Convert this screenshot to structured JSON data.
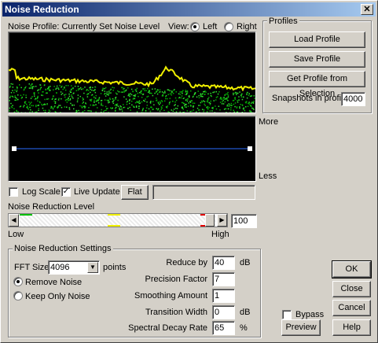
{
  "window": {
    "title": "Noise Reduction",
    "close_glyph": "✕"
  },
  "profile": {
    "caption": "Noise Profile: Currently Set Noise Level",
    "view_label": "View:",
    "view_left": "Left",
    "view_right": "Right",
    "view_selected": "Left"
  },
  "side_labels": {
    "more": "More",
    "less": "Less"
  },
  "options": {
    "log_scale": "Log Scale",
    "log_scale_checked": false,
    "live_update": "Live Update",
    "live_update_checked": true,
    "flat_button": "Flat"
  },
  "reduction_level": {
    "label": "Noise Reduction Level",
    "low": "Low",
    "high": "High",
    "value": "100"
  },
  "profiles_group": {
    "title": "Profiles",
    "load": "Load Profile",
    "save": "Save Profile",
    "get_from_selection": "Get Profile from Selection",
    "snapshots_label": "Snapshots in profile",
    "snapshots_value": "4000"
  },
  "settings": {
    "title": "Noise Reduction Settings",
    "fft_label": "FFT Size",
    "fft_value": "4096",
    "fft_unit": "points",
    "remove_noise": "Remove Noise",
    "keep_only_noise": "Keep Only Noise",
    "mode_selected": "Remove Noise",
    "reduce_by_label": "Reduce by",
    "reduce_by_value": "40",
    "reduce_by_unit": "dB",
    "precision_label": "Precision Factor",
    "precision_value": "7",
    "smoothing_label": "Smoothing Amount",
    "smoothing_value": "1",
    "transition_label": "Transition Width",
    "transition_value": "0",
    "transition_unit": "dB",
    "decay_label": "Spectral Decay Rate",
    "decay_value": "65",
    "decay_unit": "%"
  },
  "bypass": {
    "label": "Bypass",
    "checked": false
  },
  "buttons": {
    "ok": "OK",
    "close": "Close",
    "cancel": "Cancel",
    "preview": "Preview",
    "help": "Help"
  },
  "colors": {
    "graph_bg": "#000000",
    "noise_yellow": "#f0f000",
    "noise_green": "#00c000",
    "curve_blue": "#2a6bff"
  }
}
